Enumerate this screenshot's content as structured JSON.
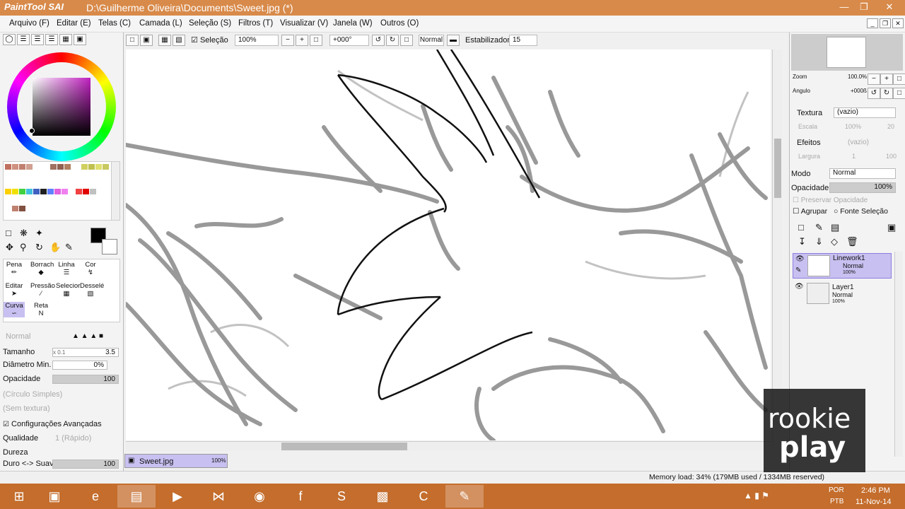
{
  "app": {
    "logo": "PaintTool SAI",
    "title": "D:\\Guilherme Oliveira\\Documents\\Sweet.jpg (*)"
  },
  "menu": [
    "Arquivo (F)",
    "Editar (E)",
    "Telas (C)",
    "Camada (L)",
    "Seleção (S)",
    "Filtros (T)",
    "Visualizar (V)",
    "Janela (W)",
    "Outros (O)"
  ],
  "toolbar": {
    "selection_label": "Seleção",
    "zoom": "100%",
    "angle": "+000°",
    "blend": "Normal",
    "stabilizer_label": "Estabilizador",
    "stabilizer_value": "15"
  },
  "left": {
    "tools": {
      "pen": "Pena",
      "eraser": "Borrach",
      "line": "Linha",
      "color": "Cor",
      "edit": "Editar",
      "pressure": "Pressão",
      "select": "Selecior",
      "deselect": "Desselé",
      "curve": "Curva",
      "straight": "Reta"
    },
    "blend_mode": "Normal",
    "size_label": "Tamanho",
    "size_mult": "x 0.1",
    "size_value": "3.5",
    "min_diam_label": "Diâmetro Min.",
    "min_diam_value": "0%",
    "opacity_label": "Opacidade",
    "opacity_value": "100",
    "shape": "(Círculo Simples)",
    "texture": "(Sem textura)",
    "adv_label": "Configurações Avançadas",
    "quality_label": "Qualidade",
    "quality_value": "1 (Rápido)",
    "hardness_label": "Dureza",
    "soft_label": "Duro <-> Suave",
    "soft_value": "100"
  },
  "navigator": {
    "zoom_label": "Zoom",
    "zoom_value": "100.0%",
    "angle_label": "Angulo",
    "angle_value": "+000ß"
  },
  "right": {
    "texture_label": "Textura",
    "texture_value": "(vazio)",
    "scale_label": "Escala",
    "scale_value": "100%",
    "scale_num": "20",
    "effects_label": "Efeitos",
    "effects_value": "(vazio)",
    "width_label": "Largura",
    "width_value": "1",
    "width_num": "100",
    "mode_label": "Modo",
    "mode_value": "Normal",
    "opacity_label": "Opacidade",
    "opacity_value": "100%",
    "preserve_label": "Preservar Opacidade",
    "group_label": "Agrupar",
    "source_label": "Fonte Seleção",
    "layers": [
      {
        "name": "Linework1",
        "mode": "Normal",
        "opacity": "100%"
      },
      {
        "name": "Layer1",
        "mode": "Normal",
        "opacity": "100%"
      }
    ]
  },
  "doc_tab": {
    "name": "Sweet.jpg",
    "zoom": "100%"
  },
  "status": {
    "memory": "Memory load: 34% (179MB used / 1334MB reserved)"
  },
  "taskbar": {
    "lang": "POR",
    "layout": "PTB",
    "time": "2:46 PM",
    "date": "11-Nov-14"
  },
  "watermark": {
    "line1": "rookie",
    "line2": "play"
  },
  "colors": {
    "titlebar": "#d88a4a",
    "taskbar": "#c46d2c",
    "selection": "#c8c0f0"
  }
}
